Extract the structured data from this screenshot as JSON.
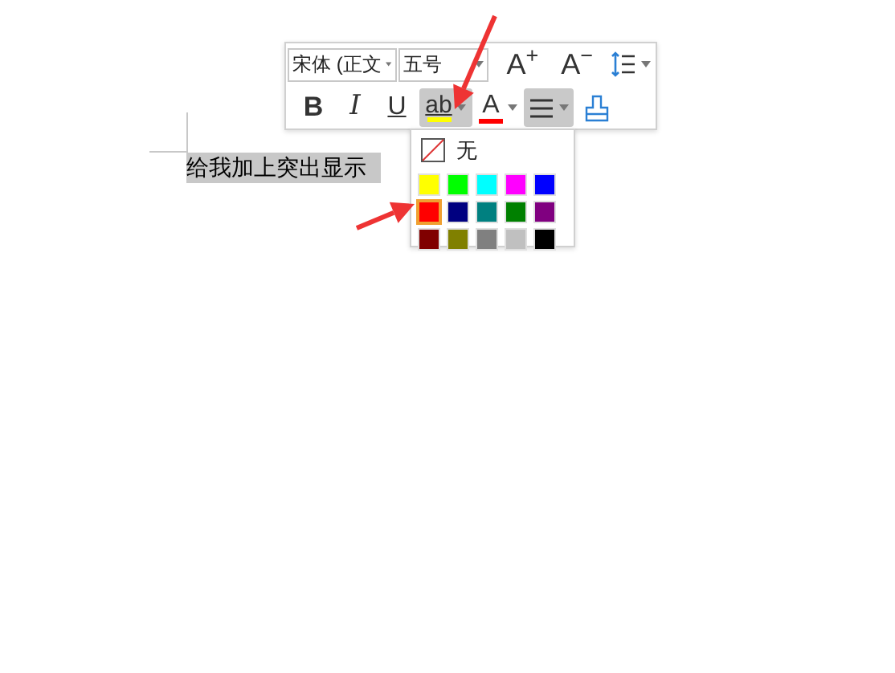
{
  "document": {
    "text": "给我加上突出显示",
    "highlighted": true
  },
  "toolbar": {
    "row_1": [
      {
        "kind": "combo",
        "value": "宋体 (正文"
      },
      {
        "kind": "combo",
        "value": "五号"
      },
      {
        "kind": "text",
        "label": "A$^{+}$",
        "dropdown": false
      },
      {
        "kind": "text",
        "label": "A$^{−}$",
        "dropdown": false
      },
      {
        "kind": "line-spacing",
        "dropdown": true
      }
    ],
    "row_2": [
      {
        "kind": "bold",
        "label": "B",
        "pressed": false,
        "dropdown": false
      },
      {
        "kind": "italic",
        "label": "I",
        "pressed": false,
        "dropdown": false
      },
      {
        "kind": "underline",
        "label": "U",
        "pressed": false,
        "dropdown": false
      },
      {
        "kind": "highlight",
        "label": "ab",
        "color": "#ffff00",
        "pressed": true,
        "dropdown": true
      },
      {
        "kind": "font-color",
        "label": "A",
        "color": "#ff0000",
        "pressed": false,
        "dropdown": true
      },
      {
        "kind": "align",
        "pressed": true,
        "dropdown": true
      },
      {
        "kind": "painter",
        "pressed": false,
        "dropdown": false
      }
    ]
  },
  "highlight_menu": {
    "none_label": "无",
    "swatches": [
      {
        "color": "#ffff00",
        "selected": false
      },
      {
        "color": "#00ff00",
        "selected": false
      },
      {
        "color": "#00ffff",
        "selected": false
      },
      {
        "color": "#ff00ff",
        "selected": false
      },
      {
        "color": "#0000ff",
        "selected": false
      },
      {
        "color": "#ff0000",
        "selected": true
      },
      {
        "color": "#000080",
        "selected": false
      },
      {
        "color": "#008080",
        "selected": false
      },
      {
        "color": "#008000",
        "selected": false
      },
      {
        "color": "#800080",
        "selected": false
      },
      {
        "color": "#800000",
        "selected": false
      },
      {
        "color": "#808000",
        "selected": false
      },
      {
        "color": "#808080",
        "selected": false
      },
      {
        "color": "#c0c0c0",
        "selected": false
      },
      {
        "color": "#000000",
        "selected": false
      }
    ]
  }
}
